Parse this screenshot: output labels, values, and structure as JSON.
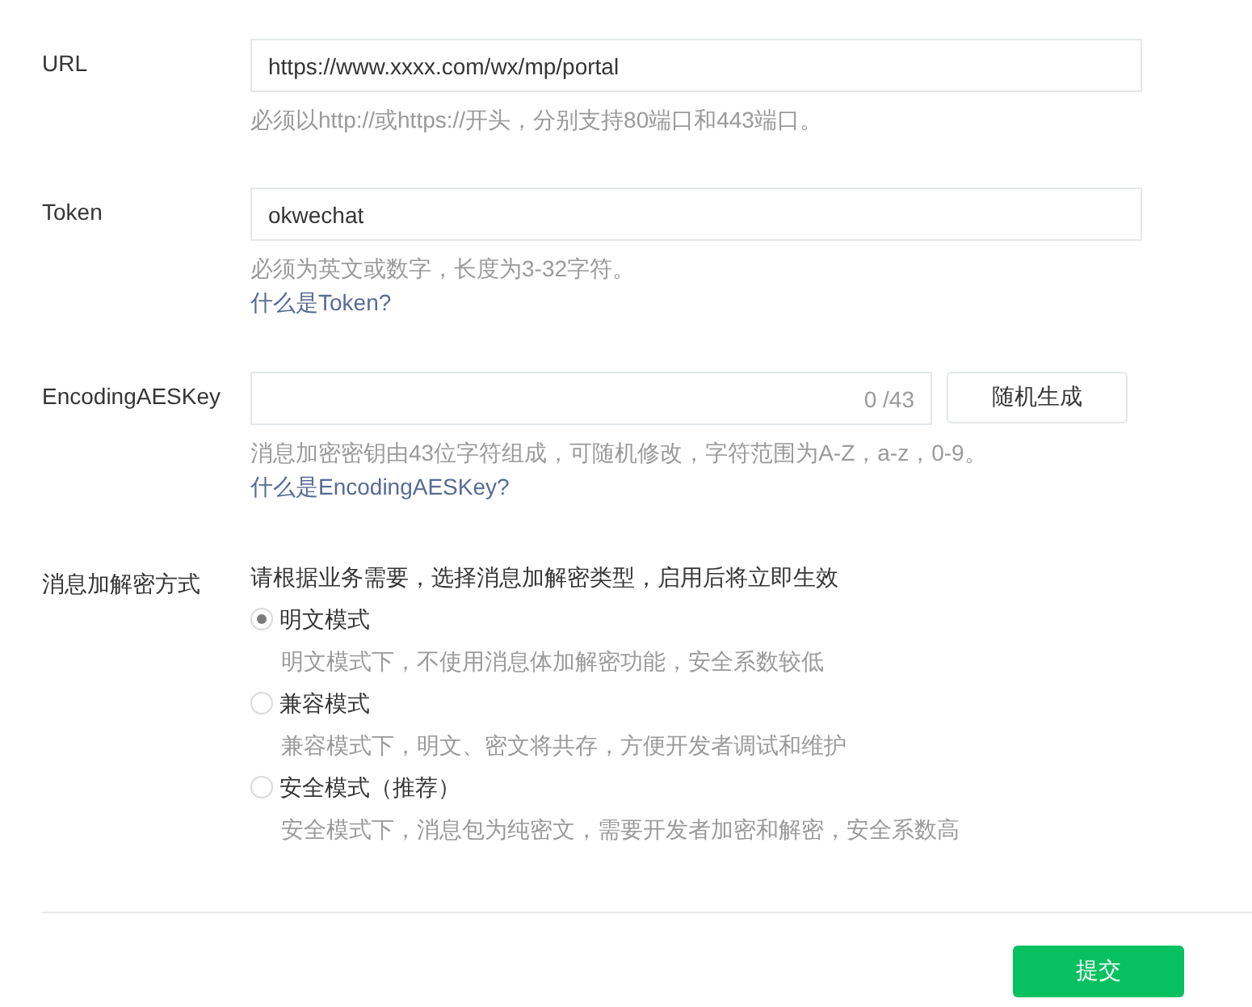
{
  "url": {
    "label": "URL",
    "value": "https://www.xxxx.com/wx/mp/portal",
    "hint": "必须以http://或https://开头，分别支持80端口和443端口。"
  },
  "token": {
    "label": "Token",
    "value": "okwechat",
    "hint": "必须为英文或数字，长度为3-32字符。",
    "link": "什么是Token?"
  },
  "aes_key": {
    "label": "EncodingAESKey",
    "counter": "0 /43",
    "button": "随机生成",
    "hint": "消息加密密钥由43位字符组成，可随机修改，字符范围为A-Z，a-z，0-9。",
    "link": "什么是EncodingAESKey?"
  },
  "mode": {
    "label": "消息加解密方式",
    "intro": "请根据业务需要，选择消息加解密类型，启用后将立即生效",
    "options": [
      {
        "label": "明文模式",
        "description": "明文模式下，不使用消息体加解密功能，安全系数较低",
        "selected": true
      },
      {
        "label": "兼容模式",
        "description": "兼容模式下，明文、密文将共存，方便开发者调试和维护",
        "selected": false
      },
      {
        "label": "安全模式（推荐）",
        "description": "安全模式下，消息包为纯密文，需要开发者加密和解密，安全系数高",
        "selected": false
      }
    ]
  },
  "submit": "提交"
}
